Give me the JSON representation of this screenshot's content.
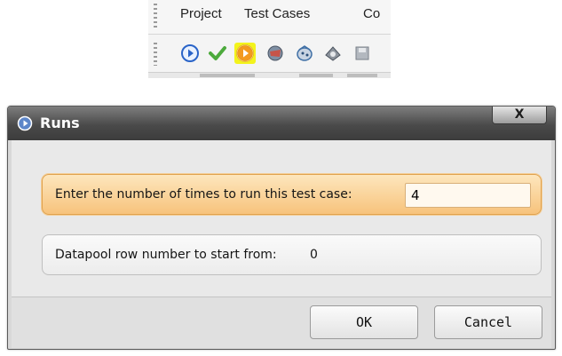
{
  "toolbar": {
    "menu": [
      "Project",
      "Test Cases",
      "Co"
    ],
    "icons": [
      "run-icon",
      "checkmark-icon",
      "run-with-iterations-icon",
      "record-icon",
      "debug-icon",
      "capture-icon",
      "save-icon"
    ]
  },
  "dialog": {
    "title": "Runs",
    "close_label": "X",
    "fields": [
      {
        "label": "Enter the number of times to run this test case:",
        "value": "4"
      },
      {
        "label": "Datapool row number to start from:",
        "value": "0"
      }
    ],
    "ok_label": "OK",
    "cancel_label": "Cancel"
  },
  "colors": {
    "highlight": "#f3f31c",
    "active_field": "#f7c37c",
    "title_bar": "#4a4a4a"
  }
}
